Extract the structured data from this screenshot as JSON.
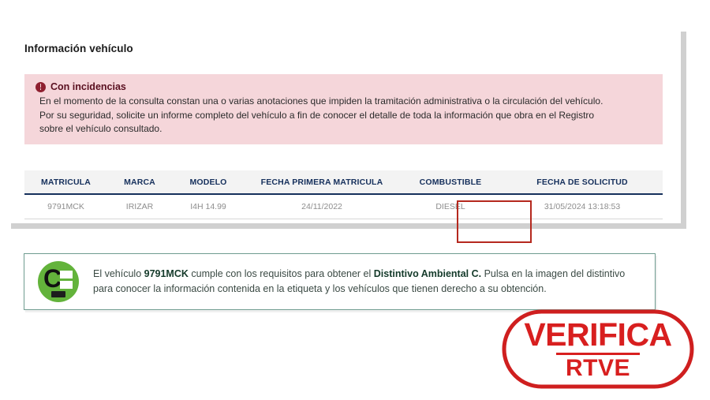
{
  "page": {
    "section_title": "Información vehículo"
  },
  "alert": {
    "icon": "exclamation-circle-icon",
    "title": "Con incidencias",
    "line1": "En el momento de la consulta constan una o varias anotaciones que impiden la tramitación administrativa o la circulación del vehículo.",
    "line2": "Por su seguridad, solicite un informe completo del vehículo a fin de conocer el detalle de toda la información que obra en el Registro",
    "line3": "sobre el vehículo consultado.",
    "bg_color": "#f5d6da",
    "title_color": "#5a1020"
  },
  "table": {
    "headers": {
      "matricula": "MATRICULA",
      "marca": "MARCA",
      "modelo": "MODELO",
      "fecha_primera_matricula": "FECHA PRIMERA MATRICULA",
      "combustible": "COMBUSTIBLE",
      "fecha_solicitud": "FECHA DE SOLICITUD"
    },
    "row": {
      "matricula": "9791MCK",
      "marca": "IRIZAR",
      "modelo": "I4H 14.99",
      "fecha_primera_matricula": "24/11/2022",
      "combustible": "DIESEL",
      "fecha_solicitud": "31/05/2024 13:18:53"
    },
    "header_color": "#16305c",
    "highlight_color": "#b5281e"
  },
  "eco": {
    "badge_letter": "C",
    "badge_color": "#63b33b",
    "text_part1": "El vehículo ",
    "plate": "9791MCK",
    "text_part2": " cumple con los requisitos para obtener el ",
    "distintivo": "Distintivo Ambiental C.",
    "text_part3": " Pulsa en la imagen del distintivo para conocer la información contenida en la etiqueta y los vehículos que tienen derecho a su obtención.",
    "border_color": "#6f9c90"
  },
  "stamp": {
    "main": "VERIFICA",
    "sub": "RTVE",
    "color": "#d81f1f"
  }
}
